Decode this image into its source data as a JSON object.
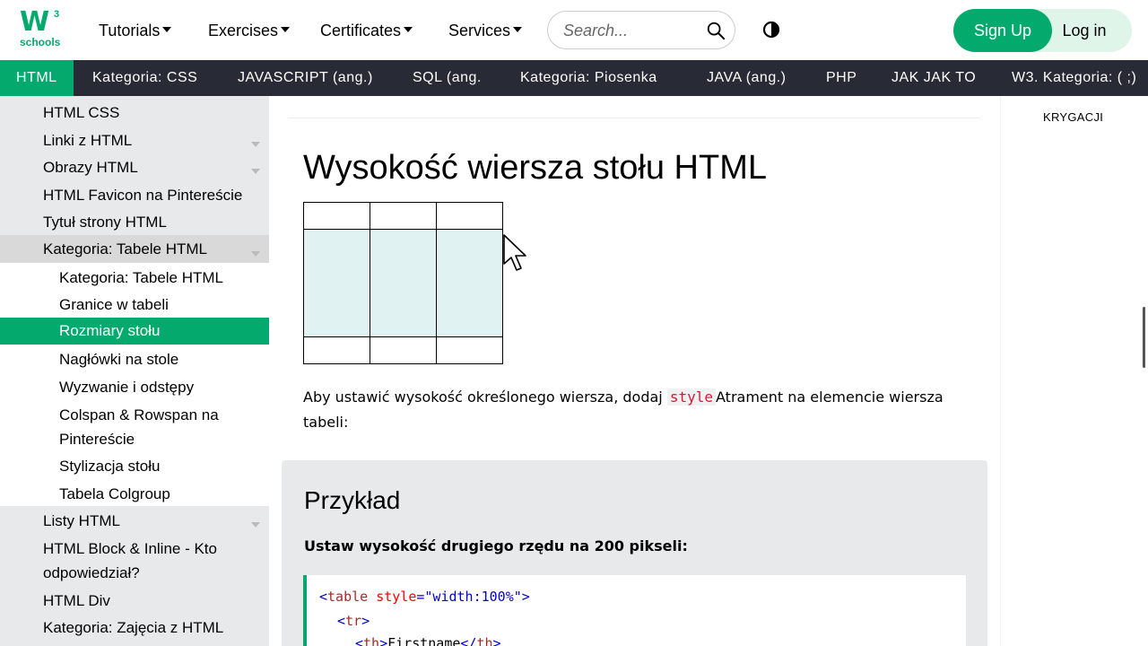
{
  "header": {
    "logo_main": "W",
    "logo_sup": "3",
    "logo_sub": "schools",
    "nav": [
      "Tutorials",
      "Exercises",
      "Certificates",
      "Services"
    ],
    "search_placeholder": "Search...",
    "signup_label": "Sign Up",
    "login_label": "Log in"
  },
  "subnav": {
    "items": [
      "HTML",
      "Kategoria: CSS",
      "JAVASCRIPT (ang.)",
      "SQL (ang.",
      "Kategoria: Piosenka",
      "JAVA (ang.)",
      "PHP",
      "JAK JAK TO",
      "W3. Kategoria: ( ;)"
    ]
  },
  "sidebar": {
    "items": [
      "HTML CSS",
      "Linki z HTML",
      "Obrazy HTML",
      "HTML Favicon na Pintereście",
      "Tytuł strony HTML",
      "Kategoria: Tabele HTML",
      "Kategoria: Tabele HTML",
      "Granice w tabeli",
      "Rozmiary stołu",
      "Nagłówki na stole",
      "Wyzwanie i odstępy",
      "Colspan & Rowspan na Pintereście",
      "Stylizacja stołu",
      "Tabela Colgroup",
      "Listy HTML",
      "HTML Block & Inline - Kto odpowiedział?",
      "HTML Div",
      "Kategoria: Zajęcia z HTML"
    ]
  },
  "main": {
    "title": "Wysokość wiersza stołu HTML",
    "paragraph_before": "Aby ustawić wysokość określonego wiersza, dodaj ",
    "paragraph_code": "style",
    "paragraph_after": "Atrament na elemencie wiersza tabeli:",
    "example_title": "Przykład",
    "example_desc": "Ustaw wysokość drugiego rzędu na 200 pikseli:",
    "code": {
      "line1_tag": "table",
      "line1_attr": "style",
      "line1_val": "\"width:100%\"",
      "line2_tag": "tr",
      "line3_tag": "th",
      "line3_text": "Firstname"
    }
  },
  "right": {
    "label": "KRYGACJI"
  },
  "colors": {
    "brand": "#04aa6d",
    "subnav_bg": "#282a35",
    "sidebar_bg": "#e7e9eb",
    "table_highlight": "#e0f2f1"
  }
}
